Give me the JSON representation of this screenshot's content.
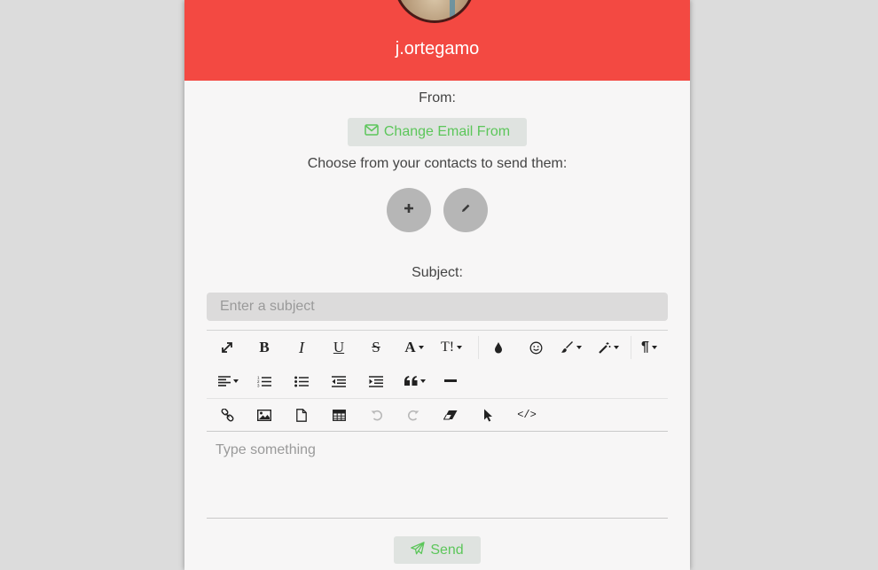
{
  "profile": {
    "username": "j.ortegamo"
  },
  "from": {
    "label": "From:",
    "change_button": "Change Email From"
  },
  "contacts": {
    "label": "Choose from your contacts to send them:",
    "add_icon": "plus-icon",
    "edit_icon": "pencil-icon"
  },
  "subject": {
    "label": "Subject:",
    "placeholder": "Enter a subject"
  },
  "editor": {
    "placeholder": "Type something",
    "toolbar": {
      "row1": [
        "fullscreen-icon",
        "bold-icon",
        "italic-icon",
        "underline-icon",
        "strikethrough-icon",
        "font-family-dropdown",
        "font-size-dropdown",
        "color-icon",
        "emoji-icon",
        "paint-brush-dropdown",
        "magic-wand-dropdown",
        "paragraph-dropdown"
      ],
      "row2": [
        "align-dropdown",
        "ordered-list-icon",
        "unordered-list-icon",
        "outdent-icon",
        "indent-icon",
        "quote-dropdown",
        "horizontal-rule-icon"
      ],
      "row3": [
        "link-icon",
        "image-icon",
        "file-icon",
        "table-icon",
        "undo-icon",
        "redo-icon",
        "eraser-icon",
        "select-pointer-icon",
        "code-view-icon"
      ]
    },
    "bold_glyph": "B",
    "italic_glyph": "I",
    "underline_glyph": "U",
    "strike_glyph": "S",
    "font_glyph": "A",
    "size_glyph": "T!",
    "paragraph_glyph": "¶",
    "code_glyph": "</>"
  },
  "send": {
    "label": "Send"
  },
  "colors": {
    "header": "#f34942",
    "accent_green": "#5cc65a",
    "card": "#f7f6f6",
    "page_bg": "#dcdcdc"
  }
}
